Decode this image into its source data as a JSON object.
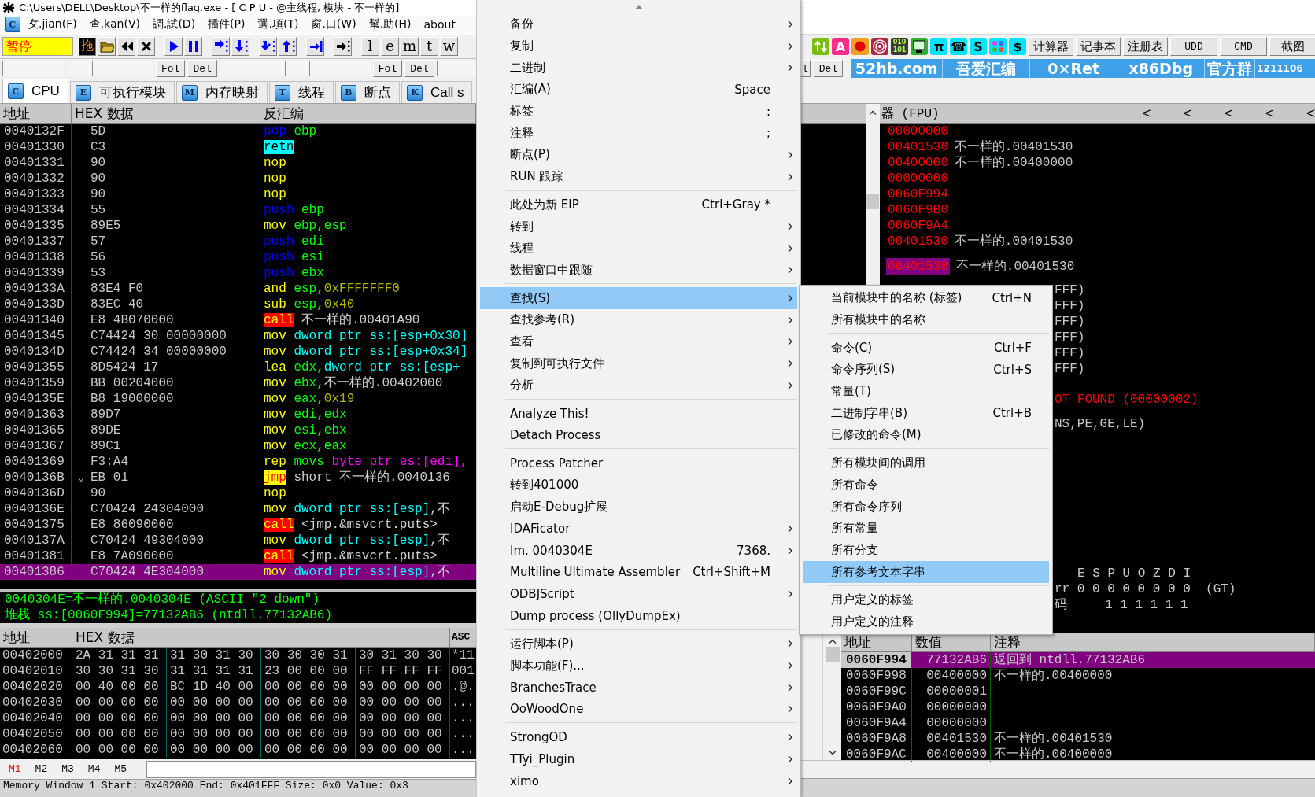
{
  "window": {
    "title": "C:\\Users\\DELL\\Desktop\\不一样的flag.exe - [ C P U  - @主线程, 模块 - 不一样的]"
  },
  "menubar": {
    "icon_letter": "C",
    "items": [
      "攵.jian(F)",
      "查.kan(V)",
      "調.試(D)",
      "插件(P)",
      "選.項(T)",
      "窗.口(W)",
      "幫.助(H)",
      "about"
    ]
  },
  "toolbar": {
    "status": "暂停",
    "drag_label": "拖",
    "letter_buttons": [
      "l",
      "e",
      "m",
      "t",
      "w"
    ],
    "tool_icons": [
      {
        "kind": "arrows"
      },
      {
        "kind": "glyph",
        "text": "A",
        "color": "#ff2d8a"
      },
      {
        "kind": "record"
      },
      {
        "kind": "target"
      },
      {
        "kind": "glyph",
        "text": "010 101",
        "color": "#3a3a3a"
      },
      {
        "kind": "screen"
      },
      {
        "kind": "glyph",
        "text": "π",
        "color": "#00e5ff"
      },
      {
        "kind": "glyph",
        "text": "☎",
        "color": "#00e5ff"
      },
      {
        "kind": "glyph",
        "text": "S",
        "color": "#00e5ff"
      },
      {
        "kind": "dots"
      },
      {
        "kind": "glyph",
        "text": "$",
        "color": "#00e5ff"
      }
    ],
    "app_buttons": [
      "计算器",
      "记事本",
      "注册表",
      "UDD",
      "CMD",
      "截图"
    ]
  },
  "toolbar2": {
    "find_bars": [
      [
        "Fol",
        "Del"
      ],
      [
        "Fol",
        "Del"
      ]
    ],
    "right_buttons": [
      "l",
      "Del"
    ],
    "banner": [
      "52hb.com",
      "吾爱汇编",
      "0×Ret",
      "x86Dbg",
      "官方群",
      "1211106"
    ]
  },
  "tabs": [
    {
      "icon": "C",
      "label": "CPU",
      "selected": true
    },
    {
      "icon": "E",
      "label": "可执行模块",
      "selected": false
    },
    {
      "icon": "M",
      "label": "内存映射",
      "selected": false
    },
    {
      "icon": "T",
      "label": "线程",
      "selected": false
    },
    {
      "icon": "B",
      "label": "断点",
      "selected": false
    },
    {
      "icon": "K",
      "label": "Call s",
      "selected": false
    }
  ],
  "disassembly": {
    "columns": [
      "地址",
      "HEX 数据",
      "反汇编"
    ],
    "rows": [
      {
        "address": "0040132F",
        "hex": "5D",
        "asm": [
          {
            "text": "pop",
            "kind": "stack"
          },
          {
            "text": " ebp",
            "kind": "reg"
          }
        ],
        "selected": false
      },
      {
        "address": "00401330",
        "hex": "C3",
        "asm": [
          {
            "text": "retn",
            "kind": "ret"
          }
        ],
        "selected": false
      },
      {
        "address": "00401331",
        "hex": "90",
        "asm": [
          {
            "text": "nop",
            "kind": "op"
          }
        ],
        "selected": false
      },
      {
        "address": "00401332",
        "hex": "90",
        "asm": [
          {
            "text": "nop",
            "kind": "op"
          }
        ],
        "selected": false
      },
      {
        "address": "00401333",
        "hex": "90",
        "asm": [
          {
            "text": "nop",
            "kind": "op"
          }
        ],
        "selected": false
      },
      {
        "address": "00401334",
        "hex": "55",
        "asm": [
          {
            "text": "push",
            "kind": "stack"
          },
          {
            "text": " ebp",
            "kind": "reg"
          }
        ],
        "selected": false
      },
      {
        "address": "00401335",
        "hex": "89E5",
        "asm": [
          {
            "text": "mov",
            "kind": "op"
          },
          {
            "text": " ebp,esp",
            "kind": "reg"
          }
        ],
        "selected": false
      },
      {
        "address": "00401337",
        "hex": "57",
        "asm": [
          {
            "text": "push",
            "kind": "stack"
          },
          {
            "text": " edi",
            "kind": "reg"
          }
        ],
        "selected": false
      },
      {
        "address": "00401338",
        "hex": "56",
        "asm": [
          {
            "text": "push",
            "kind": "stack"
          },
          {
            "text": " esi",
            "kind": "reg"
          }
        ],
        "selected": false
      },
      {
        "address": "00401339",
        "hex": "53",
        "asm": [
          {
            "text": "push",
            "kind": "stack"
          },
          {
            "text": " ebx",
            "kind": "reg"
          }
        ],
        "selected": false
      },
      {
        "address": "0040133A",
        "hex": "83E4 F0",
        "asm": [
          {
            "text": "and",
            "kind": "op"
          },
          {
            "text": " esp,",
            "kind": "reg"
          },
          {
            "text": "0xFFFFFFF0",
            "kind": "num"
          }
        ],
        "selected": false
      },
      {
        "address": "0040133D",
        "hex": "83EC 40",
        "asm": [
          {
            "text": "sub",
            "kind": "op"
          },
          {
            "text": " esp,",
            "kind": "reg"
          },
          {
            "text": "0x40",
            "kind": "num"
          }
        ],
        "selected": false
      },
      {
        "address": "00401340",
        "hex": "E8 4B070000",
        "asm": [
          {
            "text": "call",
            "kind": "call"
          },
          {
            "text": " 不一样的.00401A90",
            "kind": "sym"
          }
        ],
        "selected": false
      },
      {
        "address": "00401345",
        "hex": "C74424 30 00000000",
        "asm": [
          {
            "text": "mov",
            "kind": "op"
          },
          {
            "text": " dword ptr ss:[esp+0x30]",
            "kind": "mem"
          }
        ],
        "selected": false
      },
      {
        "address": "0040134D",
        "hex": "C74424 34 00000000",
        "asm": [
          {
            "text": "mov",
            "kind": "op"
          },
          {
            "text": " dword ptr ss:[esp+0x34]",
            "kind": "mem"
          }
        ],
        "selected": false
      },
      {
        "address": "00401355",
        "hex": "8D5424 17",
        "asm": [
          {
            "text": "lea",
            "kind": "op"
          },
          {
            "text": " edx,",
            "kind": "reg"
          },
          {
            "text": "dword ptr ss:[esp+",
            "kind": "mem"
          }
        ],
        "selected": false
      },
      {
        "address": "00401359",
        "hex": "BB 00204000",
        "asm": [
          {
            "text": "mov",
            "kind": "op"
          },
          {
            "text": " ebx,",
            "kind": "reg"
          },
          {
            "text": "不一样的.00402000",
            "kind": "sym"
          }
        ],
        "selected": false
      },
      {
        "address": "0040135E",
        "hex": "B8 19000000",
        "asm": [
          {
            "text": "mov",
            "kind": "op"
          },
          {
            "text": " eax,",
            "kind": "reg"
          },
          {
            "text": "0x19",
            "kind": "num"
          }
        ],
        "selected": false
      },
      {
        "address": "00401363",
        "hex": "89D7",
        "asm": [
          {
            "text": "mov",
            "kind": "op"
          },
          {
            "text": " edi,edx",
            "kind": "reg"
          }
        ],
        "selected": false
      },
      {
        "address": "00401365",
        "hex": "89DE",
        "asm": [
          {
            "text": "mov",
            "kind": "op"
          },
          {
            "text": " esi,ebx",
            "kind": "reg"
          }
        ],
        "selected": false
      },
      {
        "address": "00401367",
        "hex": "89C1",
        "asm": [
          {
            "text": "mov",
            "kind": "op"
          },
          {
            "text": " ecx,eax",
            "kind": "reg"
          }
        ],
        "selected": false
      },
      {
        "address": "00401369",
        "hex": "F3:A4",
        "asm": [
          {
            "text": "rep",
            "kind": "op"
          },
          {
            "text": " movs ",
            "kind": "reg"
          },
          {
            "text": "byte ptr es:[edi],",
            "kind": "seg"
          }
        ],
        "selected": false
      },
      {
        "address": "0040136B",
        "marker": "⌄",
        "hex": "EB 01",
        "asm": [
          {
            "text": "jmp",
            "kind": "jmp"
          },
          {
            "text": " short 不一样的.0040136",
            "kind": "sym"
          }
        ],
        "selected": false
      },
      {
        "address": "0040136D",
        "hex": "90",
        "asm": [
          {
            "text": "nop",
            "kind": "op"
          }
        ],
        "selected": false
      },
      {
        "address": "0040136E",
        "hex": "C70424 24304000",
        "asm": [
          {
            "text": "mov",
            "kind": "op"
          },
          {
            "text": " dword ptr ss:[esp]",
            "kind": "mem"
          },
          {
            "text": ",不",
            "kind": "sym"
          }
        ],
        "selected": false
      },
      {
        "address": "00401375",
        "hex": "E8 86090000",
        "asm": [
          {
            "text": "call",
            "kind": "call"
          },
          {
            "text": " <jmp.&msvcrt.puts>",
            "kind": "sym"
          }
        ],
        "selected": false
      },
      {
        "address": "0040137A",
        "hex": "C70424 49304000",
        "asm": [
          {
            "text": "mov",
            "kind": "op"
          },
          {
            "text": " dword ptr ss:[esp]",
            "kind": "mem"
          },
          {
            "text": ",不",
            "kind": "sym"
          }
        ],
        "selected": false
      },
      {
        "address": "00401381",
        "hex": "E8 7A090000",
        "asm": [
          {
            "text": "call",
            "kind": "call"
          },
          {
            "text": " <jmp.&msvcrt.puts>",
            "kind": "sym"
          }
        ],
        "selected": false
      },
      {
        "address": "00401386",
        "hex": "C70424 4E304000",
        "asm": [
          {
            "text": "mov",
            "kind": "op"
          },
          {
            "text": " dword ptr ss:[esp]",
            "kind": "mem"
          },
          {
            "text": ",不",
            "kind": "sym"
          }
        ],
        "selected": true
      }
    ]
  },
  "info": [
    "0040304E=不一样的.0040304E (ASCII \"2 down\")",
    "堆栈 ss:[0060F994]=77132AB6 (ntdll.77132AB6)"
  ],
  "dump": {
    "columns": [
      "地址",
      "HEX 数据",
      "ASC"
    ],
    "rows": [
      {
        "address": "00402000",
        "hex": [
          "2A 31 31 31",
          "31 30 31 30",
          "30 30 30 31",
          "30 31 30 30"
        ],
        "ascii": "*11"
      },
      {
        "address": "00402010",
        "hex": [
          "30 30 31 30",
          "31 31 31 31",
          "23 00 00 00",
          "FF FF FF FF"
        ],
        "ascii": "001"
      },
      {
        "address": "00402020",
        "hex": [
          "00 40 00 00",
          "BC 1D 40 00",
          "00 00 00 00",
          "00 00 00 00"
        ],
        "ascii": ".@."
      },
      {
        "address": "00402030",
        "hex": [
          "00 00 00 00",
          "00 00 00 00",
          "00 00 00 00",
          "00 00 00 00"
        ],
        "ascii": "..."
      },
      {
        "address": "00402040",
        "hex": [
          "00 00 00 00",
          "00 00 00 00",
          "00 00 00 00",
          "00 00 00 00"
        ],
        "ascii": "..."
      },
      {
        "address": "00402050",
        "hex": [
          "00 00 00 00",
          "00 00 00 00",
          "00 00 00 00",
          "00 00 00 00"
        ],
        "ascii": "..."
      },
      {
        "address": "00402060",
        "hex": [
          "00 00 00 00",
          "00 00 00 00",
          "00 00 00 00",
          "00 00 00 00"
        ],
        "ascii": "..."
      }
    ]
  },
  "memory_tabs": [
    {
      "label": "M1",
      "selected": true
    },
    {
      "label": "M2",
      "selected": false
    },
    {
      "label": "M3",
      "selected": false
    },
    {
      "label": "M4",
      "selected": false
    },
    {
      "label": "M5",
      "selected": false
    }
  ],
  "status_bar": "Memory Window 1  Start: 0x402000  End: 0x401FFF  Size: 0x0 Value: 0x3",
  "context_menu": {
    "items": [
      {
        "kind": "item",
        "label": "备份",
        "submenu": true,
        "selected": false
      },
      {
        "kind": "item",
        "label": "复制",
        "submenu": true,
        "selected": false
      },
      {
        "kind": "item",
        "label": "二进制",
        "submenu": true,
        "selected": false
      },
      {
        "kind": "item",
        "label": "汇编(A)",
        "shortcut": "Space",
        "submenu": false,
        "selected": false
      },
      {
        "kind": "item",
        "label": "标签",
        "shortcut": ":",
        "submenu": false,
        "selected": false
      },
      {
        "kind": "item",
        "label": "注释",
        "shortcut": ";",
        "submenu": false,
        "selected": false
      },
      {
        "kind": "item",
        "label": "断点(P)",
        "submenu": true,
        "selected": false
      },
      {
        "kind": "item",
        "label": "RUN 跟踪",
        "submenu": true,
        "selected": false
      },
      {
        "kind": "separator"
      },
      {
        "kind": "item",
        "label": "此处为新 EIP",
        "shortcut": "Ctrl+Gray *",
        "submenu": false,
        "selected": false
      },
      {
        "kind": "item",
        "label": "转到",
        "submenu": true,
        "selected": false
      },
      {
        "kind": "item",
        "label": "线程",
        "submenu": true,
        "selected": false
      },
      {
        "kind": "item",
        "label": "数据窗口中跟随",
        "submenu": true,
        "selected": false
      },
      {
        "kind": "separator"
      },
      {
        "kind": "item",
        "label": "查找(S)",
        "submenu": true,
        "selected": true
      },
      {
        "kind": "item",
        "label": "查找参考(R)",
        "submenu": true,
        "selected": false
      },
      {
        "kind": "item",
        "label": "查看",
        "submenu": true,
        "selected": false
      },
      {
        "kind": "item",
        "label": "复制到可执行文件",
        "submenu": true,
        "selected": false
      },
      {
        "kind": "item",
        "label": "分析",
        "submenu": true,
        "selected": false
      },
      {
        "kind": "separator"
      },
      {
        "kind": "item",
        "label": "Analyze This!",
        "submenu": false,
        "selected": false
      },
      {
        "kind": "item",
        "label": "Detach Process",
        "submenu": false,
        "selected": false
      },
      {
        "kind": "separator"
      },
      {
        "kind": "item",
        "label": "Process Patcher",
        "submenu": false,
        "selected": false
      },
      {
        "kind": "item",
        "label": "转到401000",
        "submenu": false,
        "selected": false
      },
      {
        "kind": "item",
        "label": "启动E-Debug扩展",
        "submenu": false,
        "selected": false
      },
      {
        "kind": "item",
        "label": "IDAFicator",
        "submenu": true,
        "selected": false
      },
      {
        "kind": "item",
        "label": "Im. 0040304E",
        "shortcut": "7368.",
        "submenu": true,
        "selected": false
      },
      {
        "kind": "item",
        "label": "Multiline Ultimate Assembler",
        "shortcut": "Ctrl+Shift+M",
        "submenu": false,
        "selected": false
      },
      {
        "kind": "item",
        "label": "ODBJScript",
        "submenu": true,
        "selected": false
      },
      {
        "kind": "item",
        "label": "Dump process (OllyDumpEx)",
        "submenu": false,
        "selected": false
      },
      {
        "kind": "separator"
      },
      {
        "kind": "item",
        "label": "运行脚本(P)",
        "submenu": true,
        "selected": false
      },
      {
        "kind": "item",
        "label": "脚本功能(F)...",
        "submenu": true,
        "selected": false
      },
      {
        "kind": "item",
        "label": "BranchesTrace",
        "submenu": true,
        "selected": false
      },
      {
        "kind": "item",
        "label": "OoWoodOne",
        "submenu": true,
        "selected": false
      },
      {
        "kind": "separator"
      },
      {
        "kind": "item",
        "label": "StrongOD",
        "submenu": true,
        "selected": false
      },
      {
        "kind": "item",
        "label": "TTyi_Plugin",
        "submenu": true,
        "selected": false
      },
      {
        "kind": "item",
        "label": "ximo",
        "submenu": true,
        "selected": false
      }
    ]
  },
  "submenu": {
    "items": [
      {
        "kind": "item",
        "label": "当前模块中的名称 (标签)",
        "shortcut": "Ctrl+N",
        "selected": false
      },
      {
        "kind": "item",
        "label": "所有模块中的名称",
        "selected": false
      },
      {
        "kind": "separator"
      },
      {
        "kind": "item",
        "label": "命令(C)",
        "shortcut": "Ctrl+F",
        "selected": false
      },
      {
        "kind": "item",
        "label": "命令序列(S)",
        "shortcut": "Ctrl+S",
        "selected": false
      },
      {
        "kind": "item",
        "label": "常量(T)",
        "selected": false
      },
      {
        "kind": "item",
        "label": "二进制字串(B)",
        "shortcut": "Ctrl+B",
        "selected": false
      },
      {
        "kind": "item",
        "label": "已修改的命令(M)",
        "selected": false
      },
      {
        "kind": "separator"
      },
      {
        "kind": "item",
        "label": "所有模块间的调用",
        "selected": false
      },
      {
        "kind": "item",
        "label": "所有命令",
        "selected": false
      },
      {
        "kind": "item",
        "label": "所有命令序列",
        "selected": false
      },
      {
        "kind": "item",
        "label": "所有常量",
        "selected": false
      },
      {
        "kind": "item",
        "label": "所有分支",
        "selected": false
      },
      {
        "kind": "item",
        "label": "所有参考文本字串",
        "selected": true
      },
      {
        "kind": "separator"
      },
      {
        "kind": "item",
        "label": "用户定义的标签",
        "selected": false
      },
      {
        "kind": "item",
        "label": "用户定义的注释",
        "selected": false
      }
    ]
  },
  "registers": {
    "title": "器 (FPU)",
    "arrows": [
      "<",
      "<",
      "<",
      "<",
      "<"
    ],
    "lines": [
      {
        "value": "00000000"
      },
      {
        "value": "00401530",
        "comment": "不一样的.00401530"
      },
      {
        "value": "00400000",
        "comment": "不一样的.00400000"
      },
      {
        "value": "00000000"
      },
      {
        "value": "0060F994"
      },
      {
        "value": "0060F9B0"
      },
      {
        "value": "0060F9A4"
      },
      {
        "value": "00401530",
        "comment": "不一样的.00401530"
      }
    ],
    "eip": {
      "value": "00401530",
      "comment": "不一样的.00401530",
      "highlighted": true
    },
    "partial_lines": [
      {
        "kind": "fpu",
        "text": "FFF)"
      },
      {
        "kind": "fpu",
        "text": "FFF)"
      },
      {
        "kind": "fpu",
        "text": "FFF)"
      },
      {
        "kind": "fpu",
        "text": "FFF)"
      },
      {
        "kind": "fpu",
        "text": "FFF)"
      },
      {
        "kind": "fpu",
        "text": "FFF)"
      },
      {
        "kind": "error",
        "text": "OT_FOUND (00000002)"
      },
      {
        "kind": "plain",
        "text": "NS,PE,GE,LE)"
      },
      {
        "kind": "flags_head",
        "text": "E S P U O Z D I"
      },
      {
        "kind": "flags",
        "text": "rr 0 0 0 0 0 0 0 0  (GT)"
      },
      {
        "kind": "flags",
        "text": "码     1 1 1 1 1 1"
      }
    ]
  },
  "stack": {
    "columns": [
      "地址",
      "数值",
      "注释"
    ],
    "rows": [
      {
        "address": "0060F994",
        "value": "77132AB6",
        "comment": "返回到 ntdll.77132AB6",
        "selected": true
      },
      {
        "address": "0060F998",
        "value": "00400000",
        "comment": "不一样的.00400000",
        "selected": false
      },
      {
        "address": "0060F99C",
        "value": "00000001",
        "selected": false
      },
      {
        "address": "0060F9A0",
        "value": "00000000",
        "selected": false
      },
      {
        "address": "0060F9A4",
        "value": "00000000",
        "selected": false
      },
      {
        "address": "0060F9A8",
        "value": "00401530",
        "comment": "不一样的.00401530",
        "selected": false
      },
      {
        "address": "0060F9AC",
        "value": "00400000",
        "comment": "不一样的.00400000",
        "selected": false
      }
    ]
  }
}
